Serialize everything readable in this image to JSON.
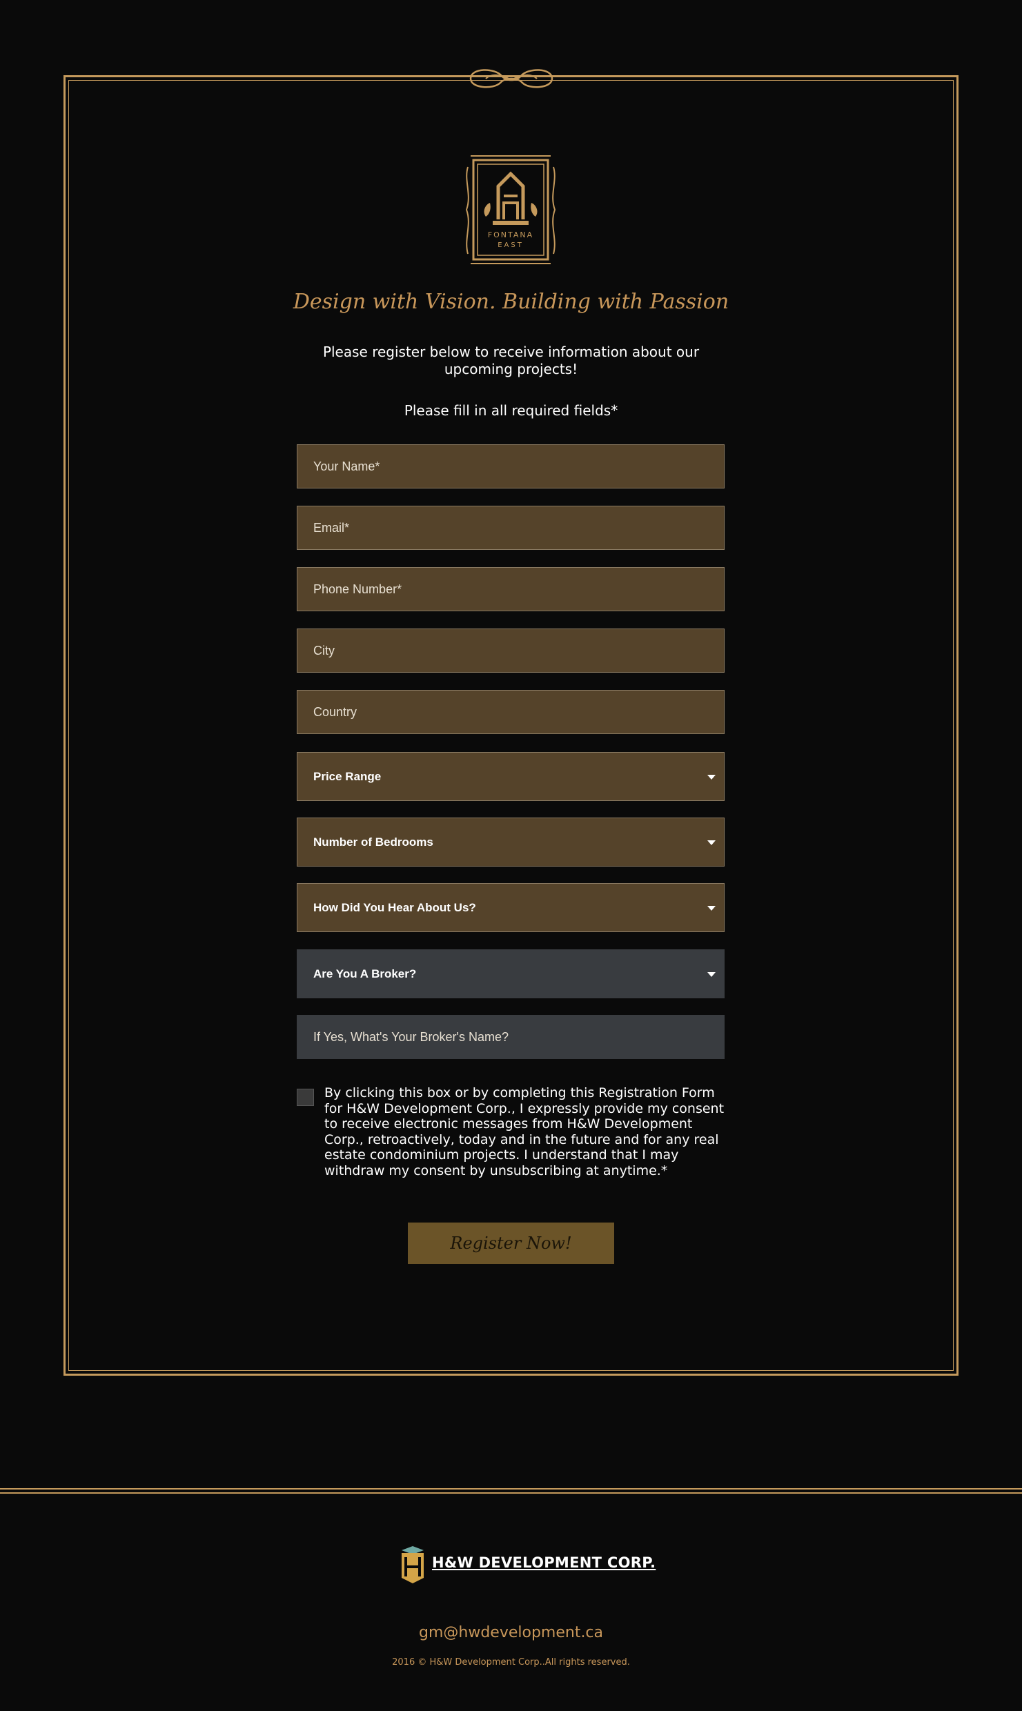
{
  "brand": {
    "logo_top": "FONTANA",
    "logo_bottom": "EAST",
    "tagline": "Design with Vision. Building with Passion"
  },
  "intro": {
    "text": "Please register below to receive information about our upcoming projects!",
    "required_note": "Please fill in all required fields*"
  },
  "form": {
    "name_placeholder": "Your Name*",
    "email_placeholder": "Email*",
    "phone_placeholder": "Phone Number*",
    "city_placeholder": "City",
    "country_placeholder": "Country",
    "price_range": "Price Range",
    "bedrooms": "Number of Bedrooms",
    "heard_about": "How Did You Hear About Us?",
    "broker": "Are You A Broker?",
    "broker_name_placeholder": "If Yes, What's Your Broker's Name?",
    "consent": "By clicking this box or by completing this Registration Form for H&W Development Corp., I expressly provide my consent to receive electronic messages from H&W Development Corp., retroactively, today and in the future and for any real estate condominium projects. I understand that I may withdraw my consent by unsubscribing at anytime.*",
    "consent_checked": false,
    "submit_label": "Register Now!"
  },
  "footer": {
    "company": "H&W DEVELOPMENT CORP.",
    "email": "gm@hwdevelopment.ca",
    "copyright": "2016 © H&W Development Corp..All rights reserved."
  },
  "colors": {
    "background": "#0a0a0a",
    "gold": "#c59a5c",
    "field_brown": "#55432a",
    "field_grey": "#393c40",
    "button": "#6b5428"
  }
}
